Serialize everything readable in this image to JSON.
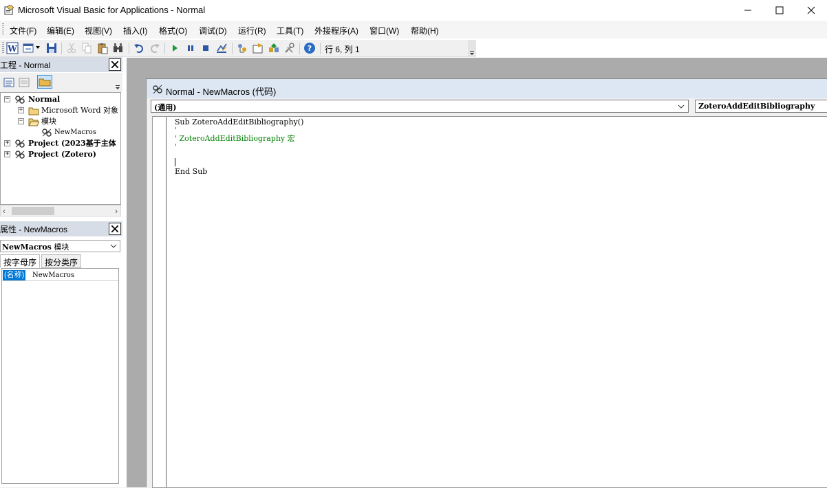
{
  "window": {
    "title": "Microsoft Visual Basic for Applications - Normal",
    "icon": "vba-editor-icon"
  },
  "menu": {
    "items": [
      {
        "label": "文件(F)"
      },
      {
        "label": "编辑(E)"
      },
      {
        "label": "视图(V)"
      },
      {
        "label": "插入(I)"
      },
      {
        "label": "格式(O)"
      },
      {
        "label": "调试(D)"
      },
      {
        "label": "运行(R)"
      },
      {
        "label": "工具(T)"
      },
      {
        "label": "外接程序(A)"
      },
      {
        "label": "窗口(W)"
      },
      {
        "label": "帮助(H)"
      }
    ]
  },
  "toolbar": {
    "cursor_position": "行 6, 列 1",
    "icons": [
      "word-icon",
      "insert-userform-icon",
      "save-icon",
      "cut-icon",
      "copy-icon",
      "paste-icon",
      "find-icon",
      "undo-icon",
      "redo-icon",
      "run-icon",
      "break-icon",
      "reset-icon",
      "design-mode-icon",
      "project-explorer-icon",
      "properties-window-icon",
      "object-browser-icon",
      "toolbox-icon",
      "help-icon"
    ]
  },
  "project_pane": {
    "title": "工程 - Normal",
    "tree": [
      {
        "label": "Normal",
        "bold": true,
        "expander": "−"
      },
      {
        "label": "Microsoft Word 对象",
        "bold": false,
        "expander": "+"
      },
      {
        "label": "模块",
        "bold": false,
        "expander": "−"
      },
      {
        "label": "NewMacros",
        "bold": false,
        "expander": ""
      },
      {
        "label": "Project (2023基于主体",
        "bold": true,
        "expander": "+"
      },
      {
        "label": "Project (Zotero)",
        "bold": true,
        "expander": "+"
      }
    ]
  },
  "properties_pane": {
    "title": "属性 - NewMacros",
    "object_name": "NewMacros",
    "object_type": "模块",
    "tabs": [
      "按字母序",
      "按分类序"
    ],
    "rows": [
      {
        "key": "(名称)",
        "value": "NewMacros"
      }
    ]
  },
  "code_window": {
    "title": "Normal - NewMacros (代码)",
    "object_combo": "(通用)",
    "procedure_combo": "ZoteroAddEditBibliography",
    "lines": [
      {
        "text": "Sub ZoteroAddEditBibliography()",
        "type": "code"
      },
      {
        "text": "'",
        "type": "comment"
      },
      {
        "text": "' ZoteroAddEditBibliography 宏",
        "type": "comment"
      },
      {
        "text": "'",
        "type": "comment"
      },
      {
        "text": "",
        "type": "code"
      },
      {
        "text": "End Sub",
        "type": "code"
      }
    ]
  },
  "colors": {
    "comment": "#008000",
    "selection": "#0078d7",
    "mdi_background": "#ababab"
  }
}
